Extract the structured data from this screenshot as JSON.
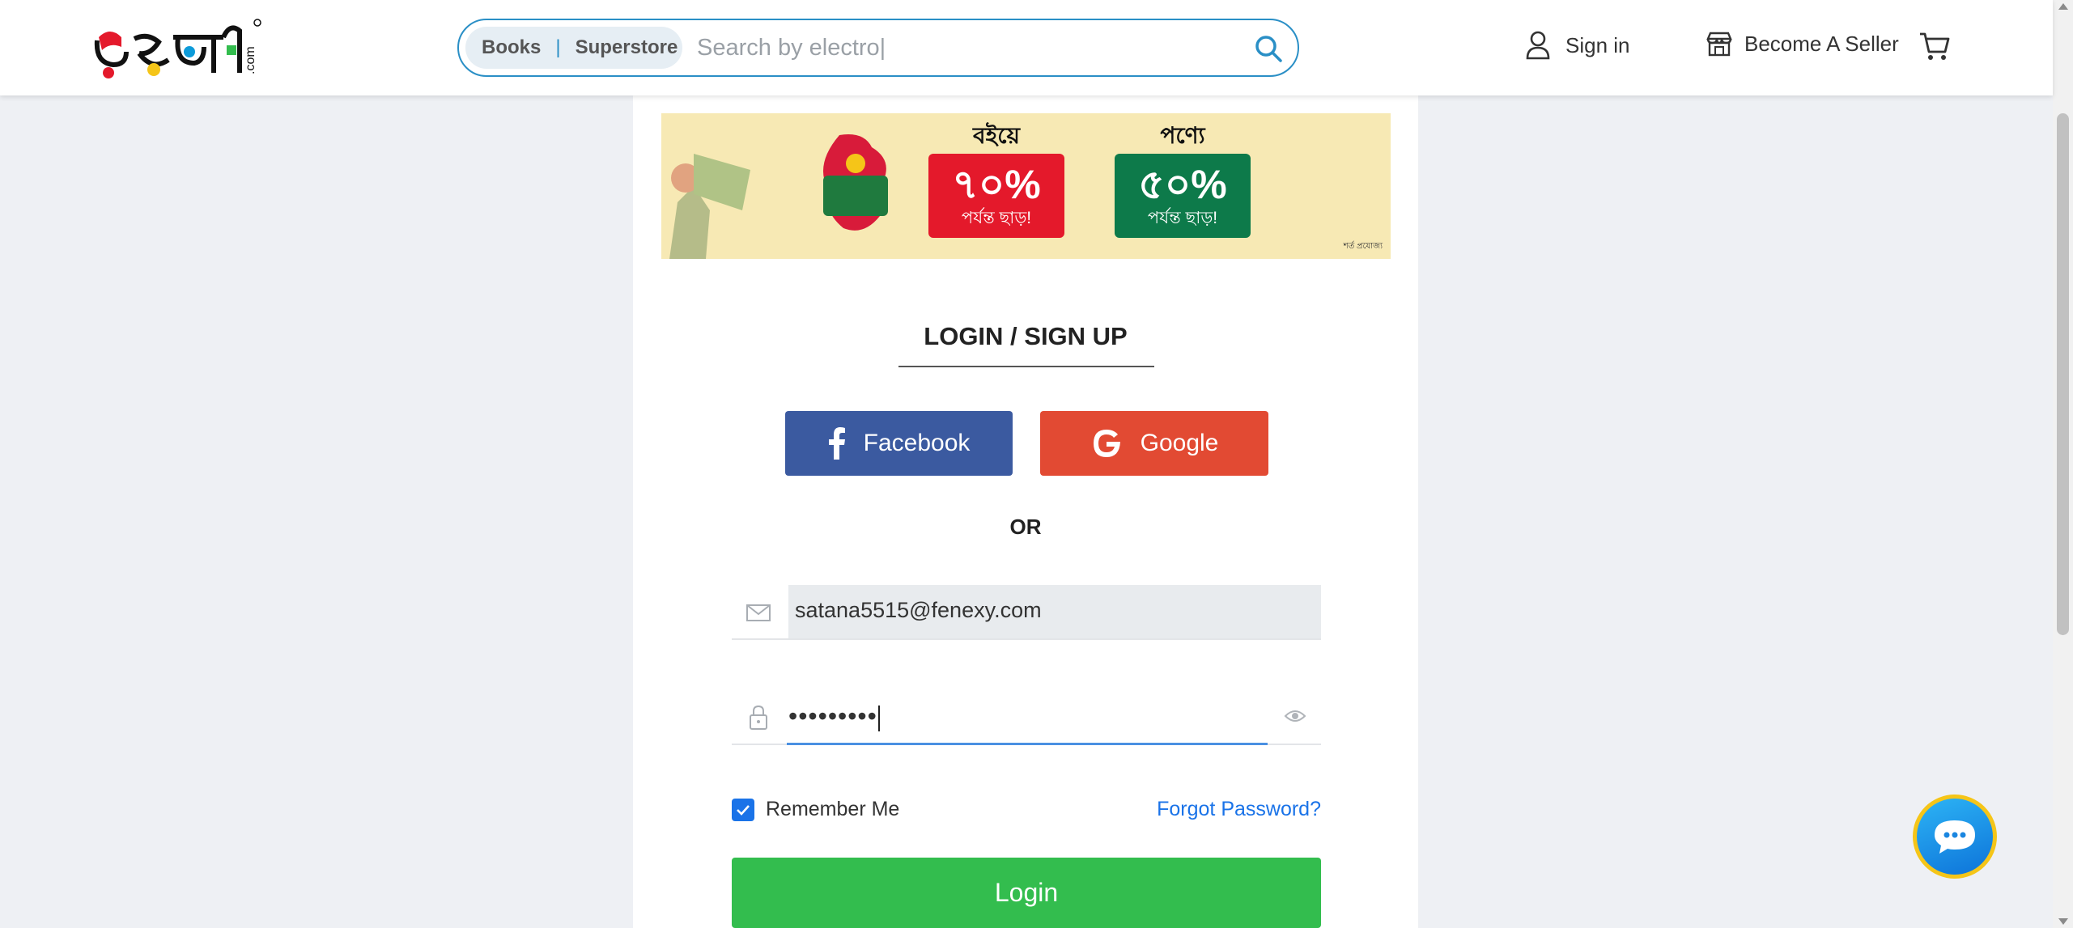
{
  "header": {
    "logo_text": "রকমারি.com",
    "search": {
      "category_1": "Books",
      "separator": "|",
      "category_2": "Superstore",
      "query": "Search by electro|"
    },
    "sign_in_label": "Sign in",
    "become_seller_label": "Become A Seller"
  },
  "banner": {
    "promo_books_label": "বইয়ে",
    "promo_books_value": "৭০%",
    "promo_books_sub": "পর্যন্ত ছাড়!",
    "promo_products_label": "পণ্যে",
    "promo_products_value": "৫০%",
    "promo_products_sub": "পর্যন্ত ছাড়!",
    "footnote": "শর্ত প্রযোজ্য"
  },
  "login": {
    "title": "LOGIN / SIGN UP",
    "facebook_label": "Facebook",
    "google_label": "Google",
    "or_label": "OR",
    "email_value": "satana5515@fenexy.com",
    "password_masked": "•••••••••",
    "remember_label": "Remember Me",
    "remember_checked": true,
    "forgot_label": "Forgot Password?",
    "login_label": "Login"
  },
  "colors": {
    "accent_blue": "#2a8fc6",
    "facebook": "#3b5aa0",
    "google": "#e24a33",
    "login_green": "#33bd4e",
    "link_blue": "#1a73e8"
  },
  "icons": [
    "logo-icon",
    "search-icon",
    "user-icon",
    "store-icon",
    "cart-icon",
    "facebook-icon",
    "google-icon",
    "mail-icon",
    "lock-icon",
    "eye-icon",
    "check-icon",
    "chat-icon"
  ]
}
